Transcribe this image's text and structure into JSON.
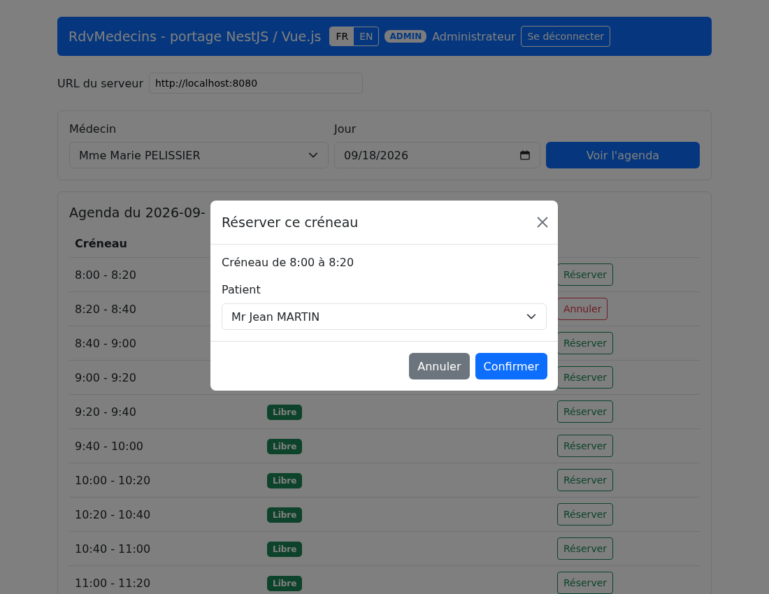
{
  "header": {
    "title": "RdvMedecins - portage NestJS / Vue.js",
    "languages": [
      {
        "label": "FR",
        "selected": true
      },
      {
        "label": "EN",
        "selected": false
      }
    ],
    "role_badge": "ADMIN",
    "user": "Administrateur",
    "logout": "Se déconnecter"
  },
  "server": {
    "label": "URL du serveur",
    "value": "http://localhost:8080"
  },
  "search": {
    "doctor_label": "Médecin",
    "doctor": "Mme Marie PELISSIER",
    "day_label": "Jour",
    "day": "09/18/2026",
    "submit": "Voir l'agenda"
  },
  "agenda": {
    "title": "Agenda du 2026-09-",
    "columns": [
      "Créneau"
    ],
    "rows": [
      {
        "time": "8:00 - 8:20",
        "action": {
          "label": "Réserver",
          "kind": "book"
        }
      },
      {
        "time": "8:20 - 8:40",
        "action": {
          "label": "Annuler",
          "kind": "cancel"
        }
      },
      {
        "time": "8:40 - 9:00",
        "action": {
          "label": "Réserver",
          "kind": "book"
        }
      },
      {
        "time": "9:00 - 9:20",
        "action": {
          "label": "Réserver",
          "kind": "book"
        }
      },
      {
        "time": "9:20 - 9:40",
        "status": "Libre",
        "action": {
          "label": "Réserver",
          "kind": "book"
        }
      },
      {
        "time": "9:40 - 10:00",
        "status": "Libre",
        "action": {
          "label": "Réserver",
          "kind": "book"
        }
      },
      {
        "time": "10:00 - 10:20",
        "status": "Libre",
        "action": {
          "label": "Réserver",
          "kind": "book"
        }
      },
      {
        "time": "10:20 - 10:40",
        "status": "Libre",
        "action": {
          "label": "Réserver",
          "kind": "book"
        }
      },
      {
        "time": "10:40 - 11:00",
        "status": "Libre",
        "action": {
          "label": "Réserver",
          "kind": "book"
        }
      },
      {
        "time": "11:00 - 11:20",
        "status": "Libre",
        "action": {
          "label": "Réserver",
          "kind": "book"
        }
      }
    ]
  },
  "modal": {
    "title": "Réserver ce créneau",
    "slot_text": "Créneau de 8:00 à 8:20",
    "patient_label": "Patient",
    "patient": "Mr Jean MARTIN",
    "cancel": "Annuler",
    "confirm": "Confirmer"
  }
}
